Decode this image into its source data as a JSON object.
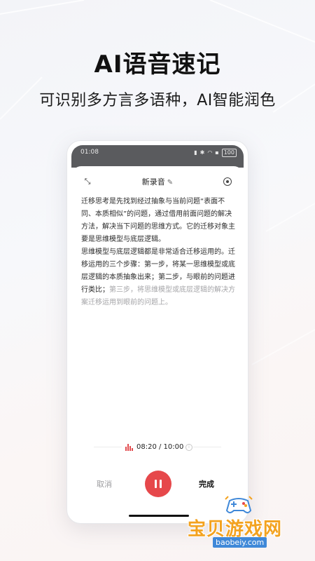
{
  "hero": {
    "title": "AI语音速记",
    "subtitle": "可识别多方言多语种，AI智能润色"
  },
  "status_bar": {
    "time": "01:08",
    "battery": "100"
  },
  "recorder": {
    "title": "新录音",
    "transcript_paragraphs": [
      "迁移思考是先找到经过抽象与当前问题“表面不同、本质相似”的问题，通过借用前面问题的解决方法，解决当下问题的思维方式。它的迁移对象主要是思维模型与底层逻辑。",
      "思维模型与底层逻辑都是非常适合迁移运用的。迁移运用的三个步骤：第一步，将某一思维模型或底层逻辑的本质抽象出来；第二步，与眼前的问题进行类比；"
    ],
    "transcript_pending": "第三步，将思维模型或底层逻辑的解决方案迁移运用到眼前的问题上。",
    "timer": "08:20 / 10:00",
    "cancel_label": "取消",
    "done_label": "完成"
  },
  "colors": {
    "accent_red": "#e6484b",
    "pending_text": "#a5a5a8",
    "watermark_orange": "#f3a21f",
    "watermark_blue": "#3f88d8"
  },
  "watermark": {
    "name": "宝贝游戏网",
    "url": "baobeiy.com"
  },
  "icons": [
    "collapse-icon",
    "edit-icon",
    "settings-icon",
    "waveform-icon",
    "info-icon",
    "pause-icon"
  ]
}
